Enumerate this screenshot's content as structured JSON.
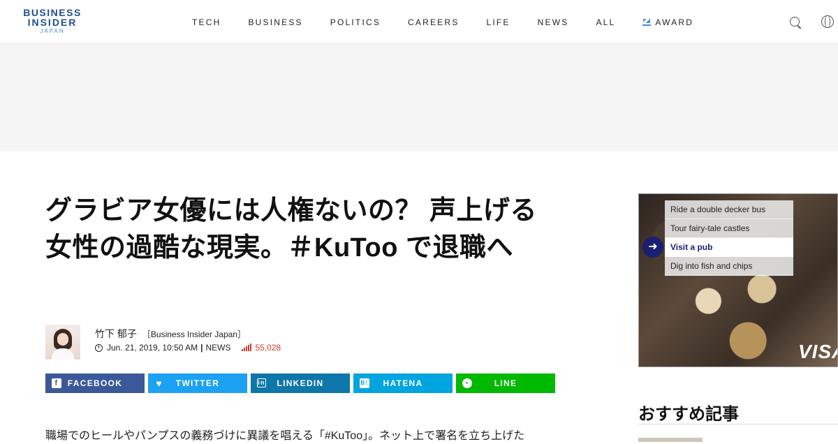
{
  "logo": {
    "line1": "BUSINESS",
    "line2": "INSIDER",
    "line3": "JAPAN"
  },
  "nav": {
    "items": [
      "TECH",
      "BUSINESS",
      "POLITICS",
      "CAREERS",
      "LIFE",
      "NEWS",
      "ALL"
    ],
    "award": "AWARD",
    "icons": [
      "search-icon",
      "globe-icon"
    ]
  },
  "article": {
    "title": "グラビア女優には人権ないの？ 声上げる女性の過酷な現実。＃KuToo で退職へ",
    "author": "竹下 郁子",
    "author_org": "［Business Insider Japan］",
    "date": "Jun. 21, 2019, 10:50 AM",
    "category": "NEWS",
    "views": "55,028",
    "body_first_line": "職場でのヒールやパンプスの義務づけに異議を唱える「#KuToo」。ネット上で署名を立ち上げた"
  },
  "share": {
    "facebook": "FACEBOOK",
    "twitter": "TWITTER",
    "linkedin": "LINKEDIN",
    "hatena": "HATENA",
    "line": "LINE"
  },
  "side_ad": {
    "options": [
      "Ride a double decker bus",
      "Tour fairy-tale castles",
      "Visit a pub",
      "Dig into fish and chips"
    ],
    "brand": "VISA"
  },
  "recommend": {
    "title": "おすすめ記事"
  },
  "colors": {
    "brand_blue": "#1f4e8c",
    "facebook": "#3b5998",
    "twitter": "#1da1f2",
    "linkedin": "#0e76a8",
    "hatena": "#00a4de",
    "line": "#00b900",
    "views_red": "#d23a2b"
  }
}
